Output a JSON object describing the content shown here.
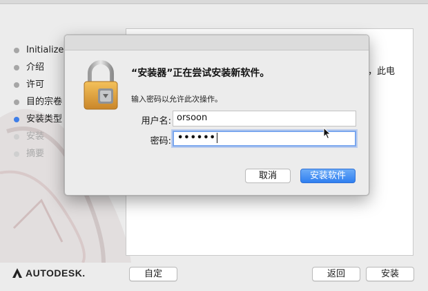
{
  "installer": {
    "steps": [
      {
        "label": "Initialize",
        "state": "done"
      },
      {
        "label": "介绍",
        "state": "done"
      },
      {
        "label": "许可",
        "state": "done"
      },
      {
        "label": "目的宗卷",
        "state": "done"
      },
      {
        "label": "安装类型",
        "state": "active"
      },
      {
        "label": "安装",
        "state": "pending"
      },
      {
        "label": "摘要",
        "state": "pending"
      }
    ],
    "pane_text": "，此电",
    "logo_text": "AUTODESK.",
    "buttons": {
      "customize": "自定",
      "back": "返回",
      "install": "安装"
    }
  },
  "dialog": {
    "heading": "“安装器”正在尝试安装新软件。",
    "subtitle": "输入密码以允许此次操作。",
    "username_label": "用户名:",
    "username_value": "orsoon",
    "password_label": "密码:",
    "password_value": "••••••",
    "cancel_label": "取消",
    "confirm_label": "安装软件"
  },
  "colors": {
    "accent": "#3f7ee8",
    "confirm_button": "#3d86f2",
    "focus_ring": "#7aa7ee"
  }
}
